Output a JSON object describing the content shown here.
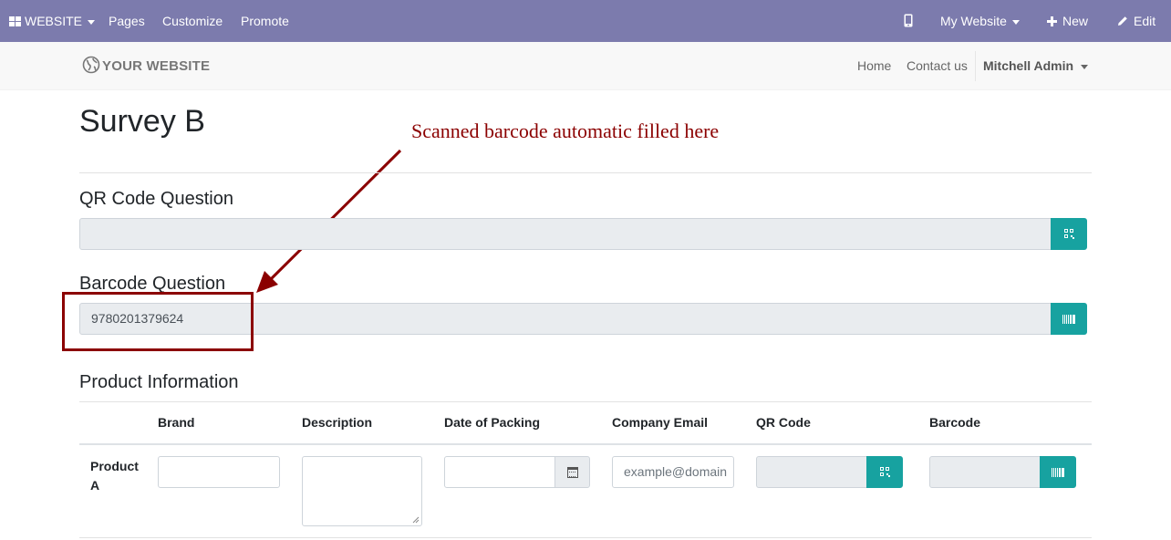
{
  "topbar": {
    "apps_label": "WEBSITE",
    "menu": [
      "Pages",
      "Customize",
      "Promote"
    ],
    "mobile_icon": "mobile-phone-icon",
    "website_selector": "My Website",
    "new_label": "New",
    "edit_label": "Edit",
    "background_color": "#7C7BAD"
  },
  "site_header": {
    "logo_text": "YOUR WEBSITE",
    "logo_icon": "globe-icon",
    "nav": [
      "Home",
      "Contact us"
    ],
    "user": "Mitchell Admin"
  },
  "survey": {
    "title": "Survey B",
    "annotation": "Scanned barcode automatic filled here",
    "questions": [
      {
        "label": "QR Code Question",
        "value": "",
        "button_icon": "qrcode-icon"
      },
      {
        "label": "Barcode Question",
        "value": "9780201379624",
        "button_icon": "barcode-icon"
      }
    ],
    "matrix": {
      "title": "Product Information",
      "columns": [
        "Brand",
        "Description",
        "Date of Packing",
        "Company Email",
        "QR Code",
        "Barcode"
      ],
      "rows": [
        {
          "label": "Product A",
          "email_placeholder": "example@domain"
        }
      ]
    },
    "accent_color": "#17a2a0",
    "annotation_color": "#8b0000"
  }
}
